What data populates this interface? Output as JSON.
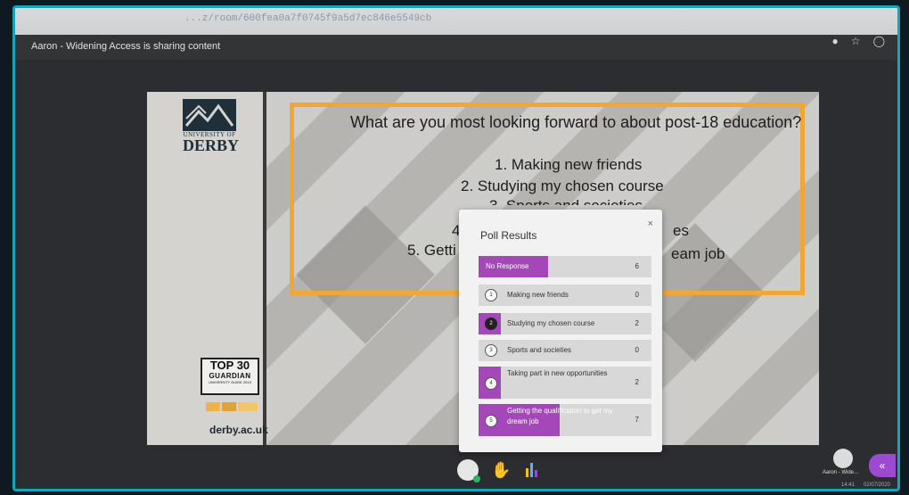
{
  "browser": {
    "url": "...z/room/600fea0a7f0745f9a5d7ec846e5549cb",
    "icons": [
      "key-icon",
      "star-icon",
      "circle-icon"
    ]
  },
  "meeting": {
    "sharing_text": "Aaron - Widening Access is sharing content",
    "participant_name": "Aaron - Wide...",
    "clock_time": "14:41",
    "clock_date": "02/07/2020"
  },
  "slide": {
    "logo_small": "UNIVERSITY OF",
    "logo_big": "DERBY",
    "badge_top": "TOP 30",
    "badge_middle": "GUARDIAN",
    "badge_bottom": "UNIVERSITY GUIDE 2019",
    "tef_label": "TEF Gold",
    "website": "derby.ac.uk",
    "question": "What are you most looking forward to about post-18 education?",
    "options": [
      "1. Making new friends",
      "2. Studying my chosen course",
      "3. Sports and societies",
      "4.",
      "es",
      "5. Getti",
      "eam job"
    ]
  },
  "poll": {
    "title": "Poll Results",
    "close": "×",
    "accent": "#a448b9",
    "no_response": {
      "label": "No Response",
      "count": "6",
      "share": 0.4
    },
    "results": [
      {
        "num": "1",
        "label": "Making new friends",
        "count": "0",
        "share": 0.0
      },
      {
        "num": "2",
        "label": "Studying my chosen course",
        "count": "2",
        "share": 0.13
      },
      {
        "num": "3",
        "label": "Sports and societies",
        "count": "0",
        "share": 0.0
      },
      {
        "num": "4",
        "label": "Taking part in new opportunities",
        "count": "2",
        "share": 0.13
      },
      {
        "num": "5",
        "label": "Getting the qualification to get my dream job",
        "count": "7",
        "share": 0.47
      }
    ]
  },
  "controls": {
    "icons": [
      "user-mic-icon",
      "hand-raise-icon",
      "poll-icon"
    ],
    "chevron": "«"
  }
}
